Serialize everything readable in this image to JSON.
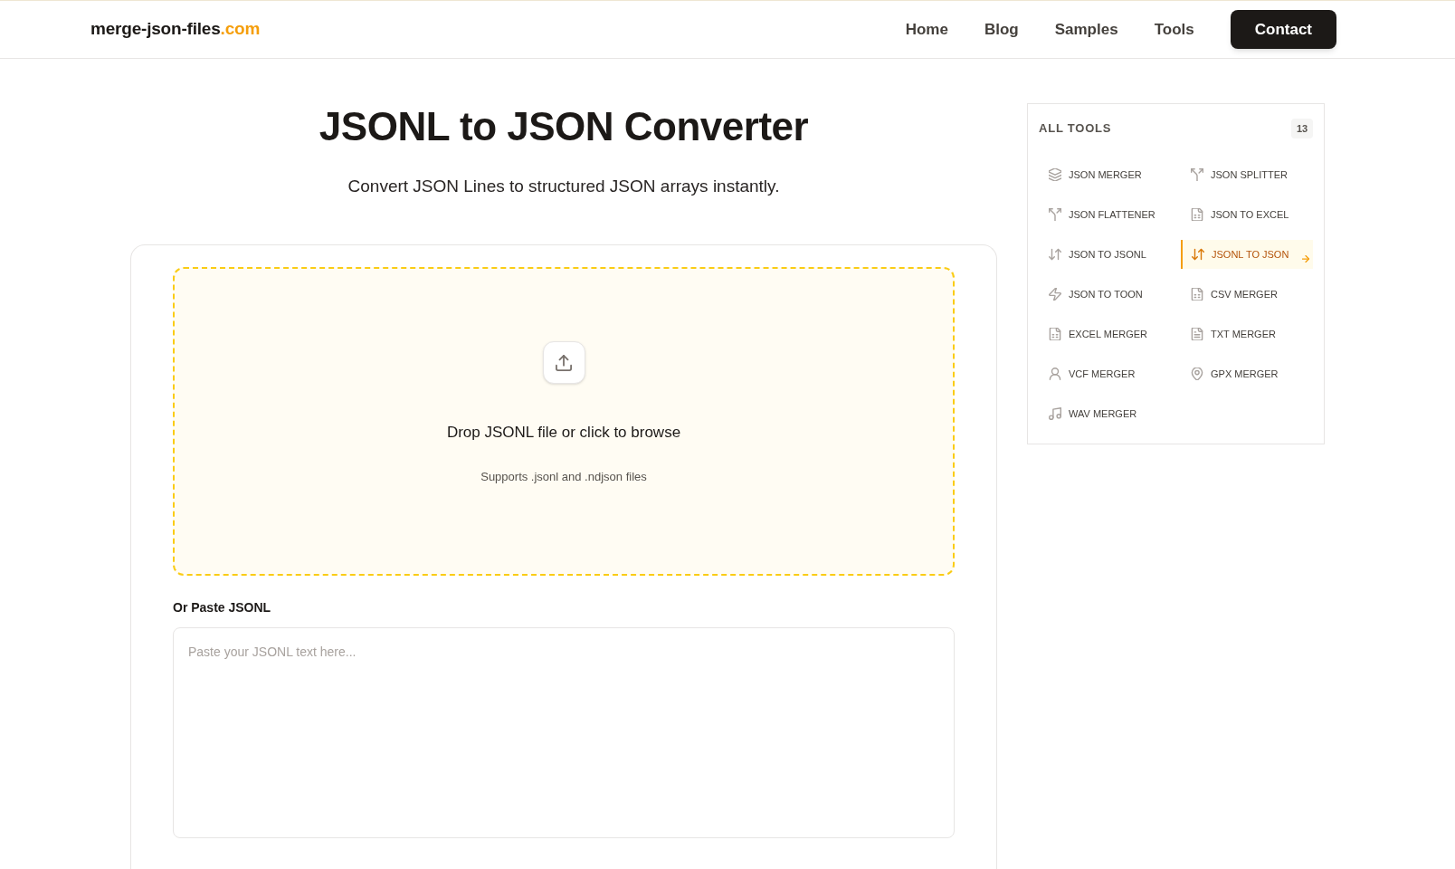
{
  "header": {
    "logo": {
      "name": "merge-json-files",
      "suffix": ".com"
    },
    "nav": [
      {
        "label": "Home"
      },
      {
        "label": "Blog"
      },
      {
        "label": "Samples"
      },
      {
        "label": "Tools"
      }
    ],
    "contact_button": "Contact"
  },
  "hero": {
    "title": "JSONL to JSON Converter",
    "subtitle": "Convert JSON Lines to structured JSON arrays instantly."
  },
  "uploader": {
    "drop_title": "Drop JSONL file or click to browse",
    "drop_hint": "Supports .jsonl and .ndjson files",
    "paste_label": "Or Paste JSONL",
    "paste_field": {
      "placeholder": "Paste your JSONL text here..."
    }
  },
  "sidebar": {
    "title": "ALL TOOLS",
    "count": "13",
    "items": [
      {
        "label": "JSON MERGER",
        "kind": "layers",
        "selected": false
      },
      {
        "label": "JSON SPLITTER",
        "kind": "split",
        "selected": false
      },
      {
        "label": "JSON FLATTENER",
        "kind": "split",
        "selected": false
      },
      {
        "label": "JSON TO EXCEL",
        "kind": "sheet",
        "selected": false
      },
      {
        "label": "JSON TO JSONL",
        "kind": "swap",
        "selected": false
      },
      {
        "label": "JSONL TO JSON",
        "kind": "swap",
        "selected": true
      },
      {
        "label": "JSON TO TOON",
        "kind": "bolt",
        "selected": false
      },
      {
        "label": "CSV MERGER",
        "kind": "sheet",
        "selected": false
      },
      {
        "label": "EXCEL MERGER",
        "kind": "sheet",
        "selected": false
      },
      {
        "label": "TXT MERGER",
        "kind": "text",
        "selected": false
      },
      {
        "label": "VCF MERGER",
        "kind": "person",
        "selected": false
      },
      {
        "label": "GPX MERGER",
        "kind": "pin",
        "selected": false
      },
      {
        "label": "WAV MERGER",
        "kind": "music",
        "selected": false
      }
    ]
  }
}
